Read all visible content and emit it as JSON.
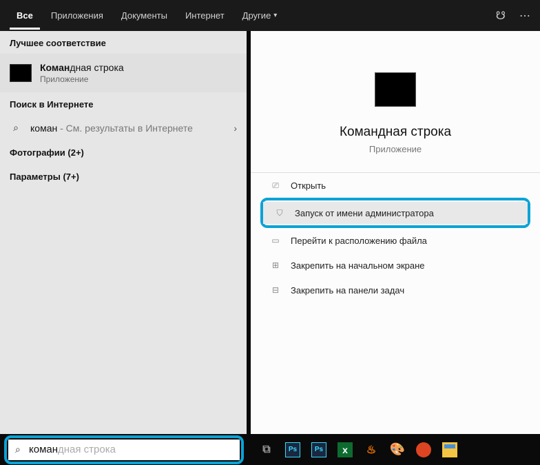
{
  "tabs": {
    "all": "Все",
    "apps": "Приложения",
    "docs": "Документы",
    "web": "Интернет",
    "more": "Другие"
  },
  "left": {
    "bestMatchHeader": "Лучшее соответствие",
    "bestMatch": {
      "titleBold": "Коман",
      "titleRest": "дная строка",
      "sub": "Приложение"
    },
    "webHeader": "Поиск в Интернете",
    "webItem": {
      "termBold": "коман",
      "suffix": " - См. результаты в Интернете"
    },
    "photos": "Фотографии (2+)",
    "params": "Параметры (7+)"
  },
  "right": {
    "title": "Командная строка",
    "sub": "Приложение",
    "actions": {
      "open": "Открыть",
      "runAdmin": "Запуск от имени администратора",
      "goto": "Перейти к расположению файла",
      "pinStart": "Закрепить на начальном экране",
      "pinTask": "Закрепить на панели задач"
    }
  },
  "search": {
    "typed": "коман",
    "suggestion": "дная строка"
  }
}
